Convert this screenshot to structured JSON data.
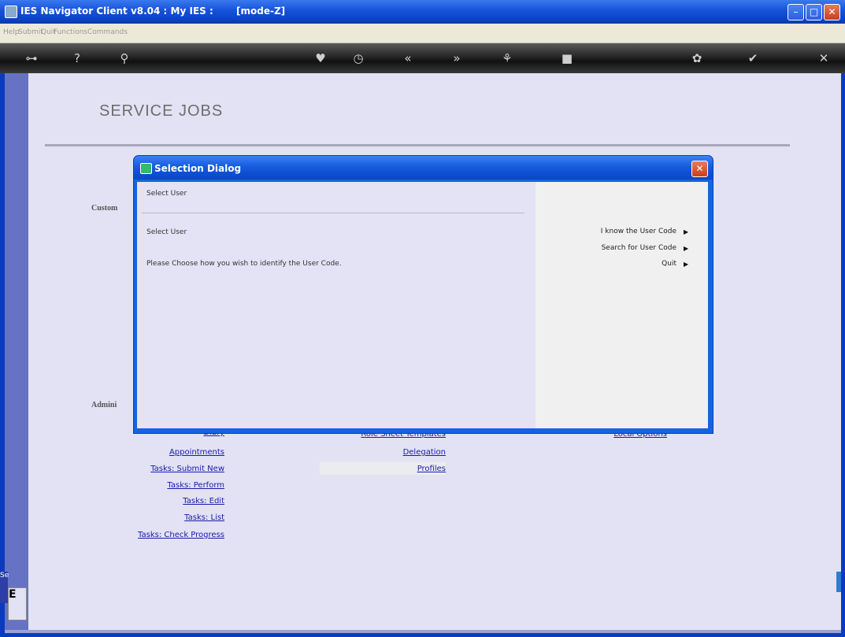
{
  "window": {
    "title": "IES Navigator Client v8.04 : My IES :       [mode-Z]",
    "controls": {
      "minimize": "–",
      "maximize": "□",
      "close": "✕"
    }
  },
  "menubar": [
    "Help",
    "Submit",
    "Quit",
    "Functions",
    "Commands"
  ],
  "toolbar": {
    "icons": [
      "key-icon",
      "help-icon",
      "search-icon",
      "heart-icon",
      "clock-icon",
      "back-icon",
      "forward-icon",
      "tree-icon",
      "stop-icon",
      "gear-icon",
      "check-icon",
      "close-icon"
    ],
    "glyphs": [
      "⊶",
      "?",
      "⚲",
      "♥",
      "◷",
      "«",
      "»",
      "⚘",
      "■",
      "✿",
      "✔",
      "✕"
    ]
  },
  "page": {
    "title": "SERVICE JOBS",
    "sections": {
      "customer": "Custom",
      "administration": "Admini"
    },
    "links_col1": [
      "Diary",
      "Appointments",
      "Tasks: Submit New",
      "Tasks: Perform",
      "Tasks: Edit",
      "Tasks: List",
      "Tasks: Check Progress"
    ],
    "links_col2": [
      "Role Sheet Templates",
      "Delegation",
      "Profiles"
    ],
    "links_col3": [
      "Local Options"
    ],
    "stub_left": "Se",
    "stub_box": "E"
  },
  "dialog": {
    "title": "Selection Dialog",
    "close": "✕",
    "header": "Select User",
    "subheader": "Select User",
    "prompt": "Please Choose how you wish to identify the User Code.",
    "options": [
      {
        "label": "I know the User Code",
        "arrow": "▶"
      },
      {
        "label": "Search for User Code",
        "arrow": "▶"
      },
      {
        "label": "Quit",
        "arrow": "▶"
      }
    ]
  }
}
